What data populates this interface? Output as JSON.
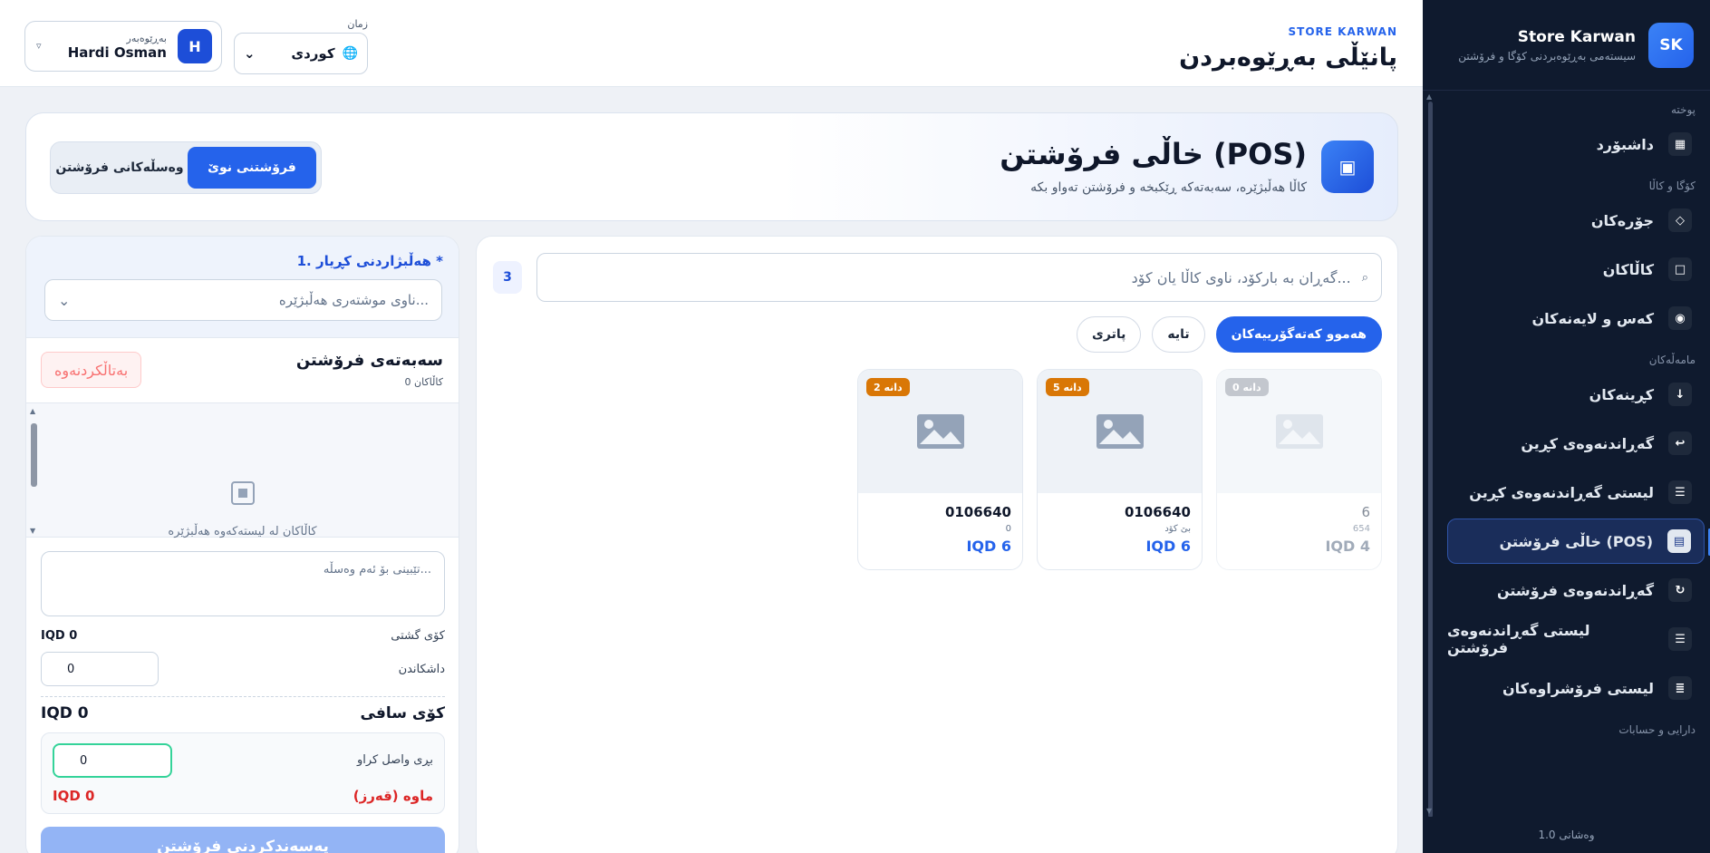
{
  "sidebar": {
    "brand_title": "Store Karwan",
    "brand_subtitle": "سیستەمی بەڕێوەبردنی کۆگا و فرۆشتن",
    "logo_text": "SK",
    "sections": {
      "overview": "پوختە",
      "inventory": "کۆگا و کاڵا",
      "transactions": "مامەڵەکان",
      "assets": "دارایی و حسابات"
    },
    "items": [
      {
        "label": "داشبۆرد",
        "icon": "grid-icon"
      },
      {
        "label": "جۆرەکان",
        "icon": "diamond-icon"
      },
      {
        "label": "کاڵاکان",
        "icon": "box-icon"
      },
      {
        "label": "کەس و لایەنەکان",
        "icon": "eye-icon"
      },
      {
        "label": "کڕینەکان",
        "icon": "arrow-down-icon"
      },
      {
        "label": "گەڕاندنەوەی کڕین",
        "icon": "return-icon"
      },
      {
        "label": "لیستی گەڕاندنەوەی کڕین",
        "icon": "list-icon"
      },
      {
        "label": "خاڵی فرۆشتن (POS)",
        "icon": "pos-icon"
      },
      {
        "label": "گەڕاندنەوەی فرۆشتن",
        "icon": "refresh-icon"
      },
      {
        "label": "لیستی گەڕاندنەوەی فرۆشتن",
        "icon": "list-icon"
      },
      {
        "label": "لیستی فرۆشراوەکان",
        "icon": "lines-icon"
      }
    ],
    "version": "وەشانی 1.0"
  },
  "header": {
    "kicker": "STORE KARWAN",
    "title": "پانێڵی بەڕێوەبردن",
    "language_label": "زمان",
    "language_value": "کوردی",
    "user_role": "بەڕێوەبەر",
    "user_name": "Hardi Osman",
    "user_initial": "H"
  },
  "hero": {
    "title": "خاڵی فرۆشتن (POS)",
    "subtitle": "کاڵا هەڵبژێرە، سەبەتەکە ڕێکبخە و فرۆشتن تەواو بکە",
    "tab_new": "فرۆشتنی نوێ",
    "tab_receipts": "وەسڵەکانی فرۆشتن"
  },
  "products": {
    "search_placeholder": "گەڕان بە بارکۆد، ناوی کاڵا یان کۆد...",
    "count": "3",
    "chips": [
      "هەموو کەتەگۆرییەکان",
      "تایە",
      "پاتری"
    ],
    "cards": [
      {
        "stock": "0 دانە",
        "name": "6",
        "code": "654",
        "price": "IQD 4",
        "out": true
      },
      {
        "stock": "5 دانە",
        "name": "0106640",
        "code": "بێ کۆد",
        "price": "IQD 6",
        "out": false
      },
      {
        "stock": "2 دانە",
        "name": "0106640",
        "code": "0",
        "price": "IQD 6",
        "out": false
      }
    ]
  },
  "cart": {
    "customer_label": "1. هەڵبژاردنی کڕیار *",
    "customer_placeholder": "ناوی موشتەری هەڵبژێرە...",
    "title": "سەبەتەی فرۆشتن",
    "item_count": "0 کاڵاکان",
    "cancel": "بەتاڵکردنەوە",
    "empty_text": "کاڵاکان لە لیستەکەوە هەڵبژێرە",
    "note_placeholder": "تێبینی بۆ ئەم وەسڵە...",
    "subtotal_label": "کۆی گشتی",
    "subtotal_value": "IQD 0",
    "discount_label": "داشکاندن",
    "discount_value": "0",
    "net_label": "کۆی سافی",
    "net_value": "IQD 0",
    "paid_label": "بڕی واصل کراو",
    "paid_value": "0",
    "due_label": "ماوە (قەرز)",
    "due_value": "IQD 0",
    "submit": "پەسەندکردنی فرۆشتن"
  }
}
